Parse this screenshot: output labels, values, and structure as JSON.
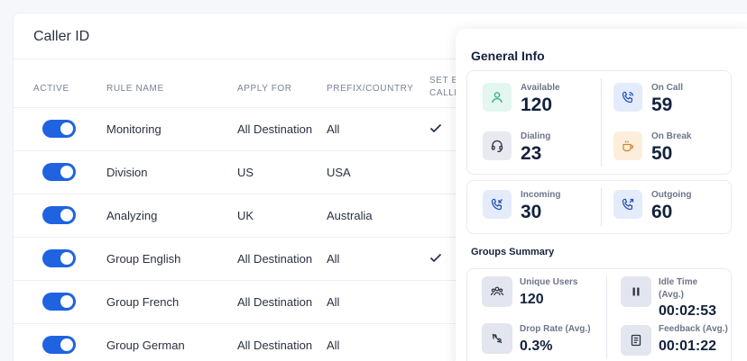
{
  "caller": {
    "title": "Caller ID",
    "columns": {
      "active": "ACTIVE",
      "rule_name": "RULE NAME",
      "apply_for": "APPLY FOR",
      "prefix": "PREFIX/COUNTRY",
      "set_by_line1": "SET BY",
      "set_by_line2": "CALLE"
    },
    "rows": [
      {
        "active": true,
        "rule_name": "Monitoring",
        "apply_for": "All Destination",
        "prefix": "All",
        "set_by": true
      },
      {
        "active": true,
        "rule_name": "Division",
        "apply_for": "US",
        "prefix": "USA",
        "set_by": false
      },
      {
        "active": true,
        "rule_name": "Analyzing",
        "apply_for": "UK",
        "prefix": "Australia",
        "set_by": false
      },
      {
        "active": true,
        "rule_name": "Group English",
        "apply_for": "All Destination",
        "prefix": "All",
        "set_by": true
      },
      {
        "active": true,
        "rule_name": "Group French",
        "apply_for": "All Destination",
        "prefix": "All",
        "set_by": false
      },
      {
        "active": true,
        "rule_name": "Group German",
        "apply_for": "All Destination",
        "prefix": "All",
        "set_by": false
      }
    ]
  },
  "general": {
    "title": "General Info",
    "available": {
      "label": "Available",
      "value": "120",
      "icon": "user-icon"
    },
    "on_call": {
      "label": "On Call",
      "value": "59",
      "icon": "phone-call-icon"
    },
    "dialing": {
      "label": "Dialing",
      "value": "23",
      "icon": "headset-icon"
    },
    "on_break": {
      "label": "On Break",
      "value": "50",
      "icon": "coffee-icon"
    },
    "incoming": {
      "label": "Incoming",
      "value": "30",
      "icon": "incoming-call-icon"
    },
    "outgoing": {
      "label": "Outgoing",
      "value": "60",
      "icon": "outgoing-call-icon"
    }
  },
  "groups": {
    "title": "Groups Summary",
    "unique_users": {
      "label": "Unique Users",
      "value": "120",
      "icon": "users-icon"
    },
    "idle_time": {
      "label_line1": "Idle Time",
      "label_line2": "(Avg.)",
      "value": "00:02:53",
      "icon": "pause-icon"
    },
    "drop_rate": {
      "label": "Drop Rate (Avg.)",
      "value": "0.3%",
      "icon": "missed-call-icon"
    },
    "feedback": {
      "label": "Feedback (Avg.)",
      "value": "00:01:22",
      "icon": "document-icon"
    }
  },
  "colors": {
    "toggle_on": "#1f63e0",
    "accent_green": "#2fae7e",
    "accent_blue": "#2454b8",
    "accent_peach": "#c98a3c"
  }
}
